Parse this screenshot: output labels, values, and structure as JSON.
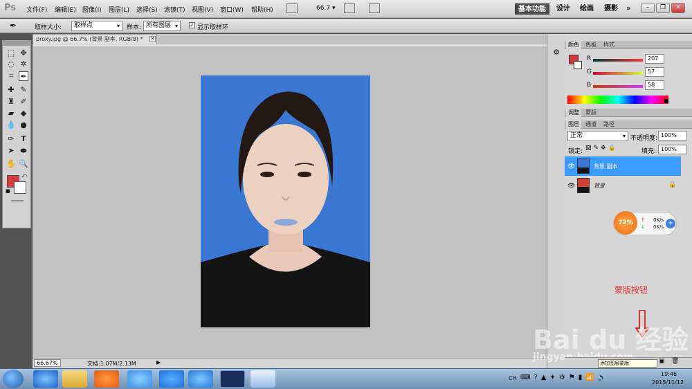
{
  "app": {
    "logo": "Ps"
  },
  "menu": [
    "文件(F)",
    "编辑(E)",
    "图像(I)",
    "图层(L)",
    "选择(S)",
    "滤镜(T)",
    "视图(V)",
    "窗口(W)",
    "帮助(H)"
  ],
  "zoom": "66.7",
  "workspaces": [
    "基本功能",
    "设计",
    "绘画",
    "摄影",
    "»"
  ],
  "options": {
    "sample_size_label": "取样大小:",
    "sample_size_value": "取样点",
    "sample_label": "样本:",
    "sample_value": "所有图层",
    "show_ring_label": "显示取样环",
    "show_ring_checked": true
  },
  "document": {
    "tab": "proxy.jpg @ 66.7% (背景 副本, RGB/8) *",
    "status_zoom": "66.67%",
    "status_doc": "文档:1.07M/2.13M"
  },
  "color_panel": {
    "tabs": [
      "颜色",
      "色板",
      "样式"
    ],
    "r_label": "R",
    "r": "207",
    "g_label": "G",
    "g": "57",
    "b_label": "B",
    "b": "58",
    "fg_color": "#cf393a"
  },
  "adjust_panel": {
    "tabs": [
      "调整",
      "蒙版"
    ]
  },
  "layers_panel": {
    "tabs": [
      "图层",
      "通道",
      "路径"
    ],
    "blend_mode": "正常",
    "opacity_label": "不透明度:",
    "opacity": "100%",
    "lock_label": "锁定:",
    "fill_label": "填充:",
    "fill": "100%",
    "layers": [
      {
        "name": "背景 副本",
        "selected": true
      },
      {
        "name": "背景",
        "selected": false
      }
    ]
  },
  "speed_widget": {
    "percent": "72%",
    "up": "0K/s",
    "down": "0K/s"
  },
  "annotation": "蒙版按钮",
  "tooltip": "添加图层蒙版",
  "watermark": {
    "brand": "Bai du 经验",
    "url": "jingyan.baidu.com"
  },
  "taskbar": {
    "lang": "CH",
    "time": "19:46",
    "date": "2015/11/12"
  }
}
